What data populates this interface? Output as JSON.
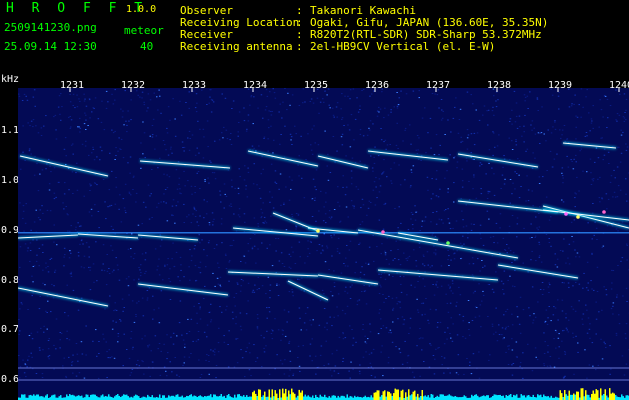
{
  "header": {
    "brand": "H R O F F T",
    "version": "1.0.0",
    "file_name": "2509141230.png",
    "timestamp": "25.09.14 12:30",
    "meteor_label": "meteor",
    "meteor_count": "40",
    "info": [
      {
        "label": "Observer",
        "value": "Takanori Kawachi"
      },
      {
        "label": "Receiving Location",
        "value": "Ogaki, Gifu, JAPAN (136.60E, 35.35N)"
      },
      {
        "label": "Receiver",
        "value": "R820T2(RTL-SDR) SDR-Sharp 53.372MHz"
      },
      {
        "label": "Receiving antenna",
        "value": "2el-HB9CV Vertical (el. E-W)"
      }
    ],
    "separator": ":"
  },
  "axis": {
    "y_unit": "kHz",
    "y_ticks": [
      "1.1",
      "1.0",
      "0.9",
      "0.8",
      "0.7",
      "0.6"
    ],
    "x_ticks": [
      "1231",
      "1232",
      "1233",
      "1234",
      "1235",
      "1236",
      "1237",
      "1238",
      "1239",
      "1240"
    ]
  },
  "colors": {
    "background": "#030a55",
    "header_text": "#00ff00",
    "info_text": "#ffff00",
    "trace_core": "#ffffff",
    "trace_glow": "#00e0ff",
    "level_bars": "#00e5ff",
    "level_peaks": "#ffff00"
  }
}
